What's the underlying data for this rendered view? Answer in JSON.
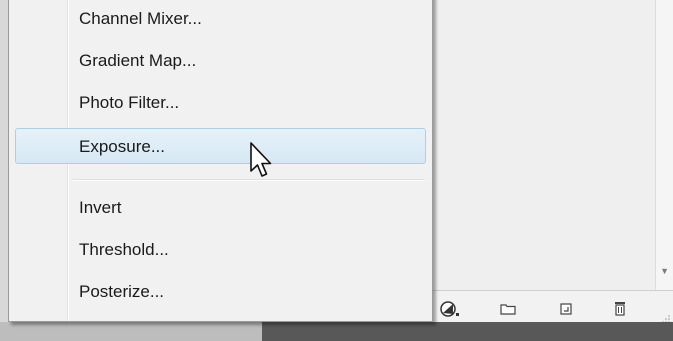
{
  "menu": {
    "items": [
      {
        "label": "Channel Mixer..."
      },
      {
        "label": "Gradient Map..."
      },
      {
        "label": "Photo Filter..."
      },
      {
        "label": "Exposure...",
        "highlighted": true
      },
      {
        "label": "Invert"
      },
      {
        "label": "Threshold..."
      },
      {
        "label": "Posterize..."
      }
    ]
  },
  "panel_toolbar": {
    "buttons": [
      {
        "icon": "adjustment-layer-icon"
      },
      {
        "icon": "folder-icon"
      },
      {
        "icon": "new-layer-icon"
      },
      {
        "icon": "trash-icon"
      }
    ]
  },
  "colors": {
    "menu_bg": "#f1f1f1",
    "highlight_bg": "#d6e8f4",
    "highlight_border": "#a8d0ea",
    "text": "#1a1a1a"
  }
}
